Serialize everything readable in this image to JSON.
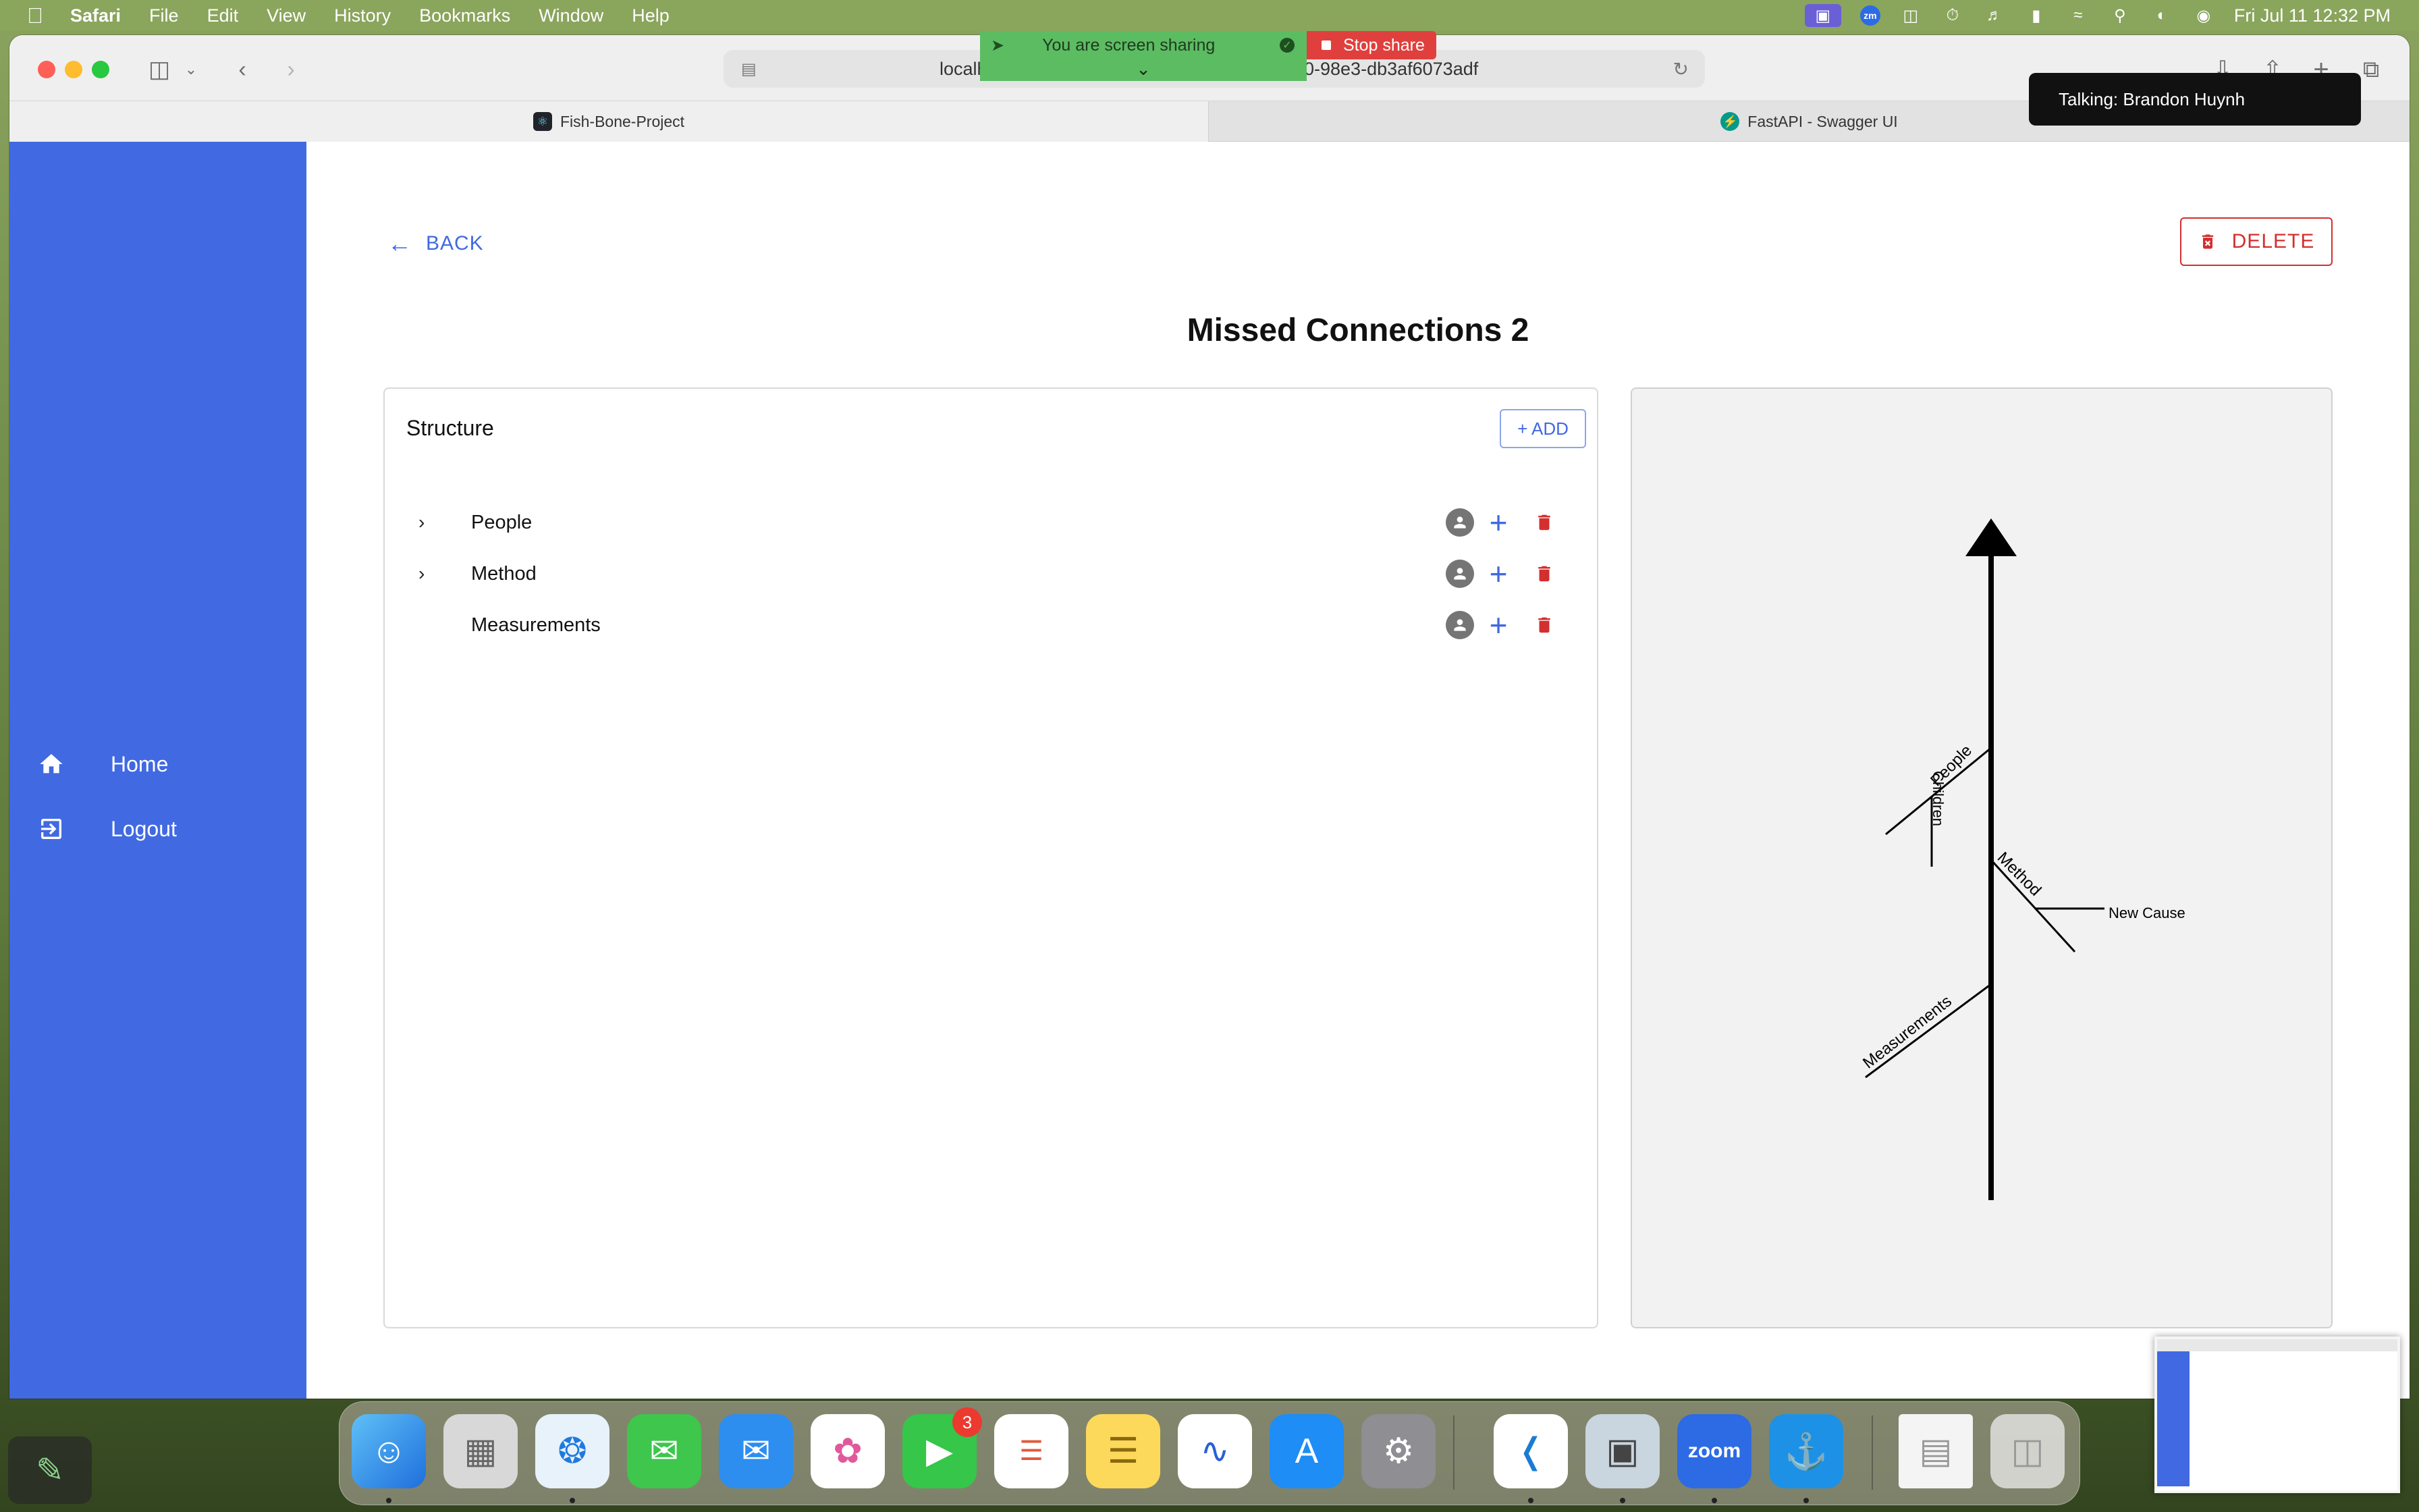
{
  "menubar": {
    "app_name": "Safari",
    "items": [
      "File",
      "Edit",
      "View",
      "History",
      "Bookmarks",
      "Window",
      "Help"
    ],
    "clock": "Fri Jul 11  12:32 PM",
    "zoom_chip": "zm"
  },
  "browser": {
    "url_left": "localh",
    "url_right": "0-98e3-db3af6073adf",
    "tabs": [
      {
        "title": "Fish-Bone-Project",
        "active": true
      },
      {
        "title": "FastAPI - Swagger UI",
        "active": false
      }
    ]
  },
  "screen_share": {
    "banner_text": "You are screen sharing",
    "stop_label": "Stop share",
    "talking": "Talking: Brandon Huynh"
  },
  "sidebar": {
    "items": [
      {
        "label": "Home",
        "icon": "home-icon"
      },
      {
        "label": "Logout",
        "icon": "logout-icon"
      }
    ]
  },
  "header": {
    "back_label": "BACK",
    "delete_label": "DELETE",
    "title": "Missed Connections 2"
  },
  "structure": {
    "title": "Structure",
    "add_label": "+ ADD",
    "rows": [
      {
        "label": "People",
        "expandable": true
      },
      {
        "label": "Method",
        "expandable": true
      },
      {
        "label": "Measurements",
        "expandable": false
      }
    ]
  },
  "diagram": {
    "labels": {
      "people": "People",
      "people_child": "Children",
      "method": "Method",
      "method_child": "New Cause",
      "measurements": "Measurements"
    }
  },
  "dock": {
    "facetime_badge": "3",
    "zoom_label": "zoom"
  },
  "colors": {
    "sidebar": "#4169e1",
    "accent": "#4169e1",
    "danger": "#d32f2f",
    "share_green": "#5cbc62",
    "stop_red": "#e0403d"
  }
}
